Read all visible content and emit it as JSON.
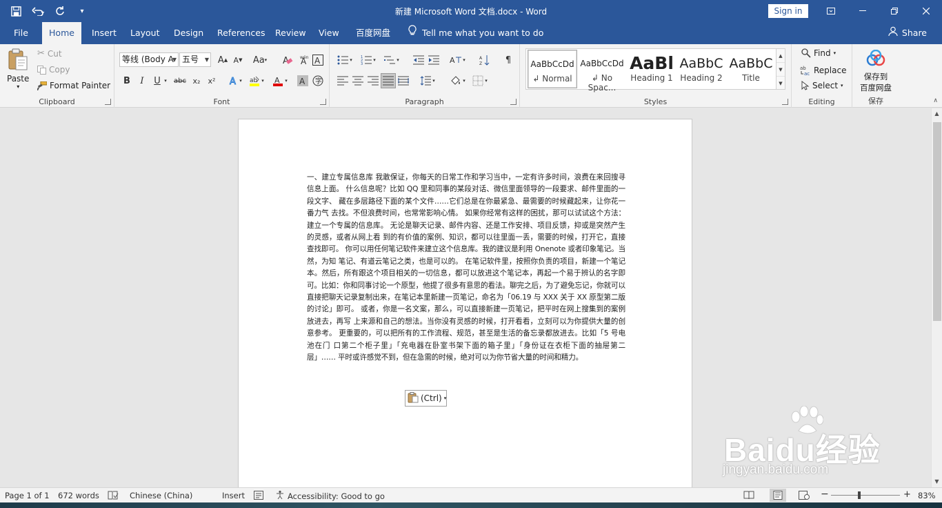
{
  "titlebar": {
    "title": "新建 Microsoft Word 文档.docx  -  Word",
    "sign_in": "Sign in"
  },
  "tabs": {
    "items": [
      "File",
      "Home",
      "Insert",
      "Layout",
      "Design",
      "References",
      "Review",
      "View",
      "百度网盘"
    ],
    "active": "Home",
    "tell_me": "Tell me what you want to do",
    "share": "Share"
  },
  "ribbon": {
    "clipboard": {
      "label": "Clipboard",
      "paste": "Paste",
      "cut": "Cut",
      "copy": "Copy",
      "format_painter": "Format Painter"
    },
    "font": {
      "label": "Font",
      "font_name": "等线 (Body A",
      "font_size": "五号",
      "bold": "B",
      "italic": "I",
      "underline": "U",
      "strikethrough": "abc",
      "subscript": "x₂",
      "superscript": "x²",
      "change_case": "Aa",
      "highlight_color": "#ffff00",
      "font_color": "#e00000"
    },
    "paragraph": {
      "label": "Paragraph"
    },
    "styles": {
      "label": "Styles",
      "items": [
        {
          "sample": "AaBbCcDd",
          "name": "↲ Normal"
        },
        {
          "sample": "AaBbCcDd",
          "name": "↲ No Spac..."
        },
        {
          "sample": "AaBl",
          "name": "Heading 1"
        },
        {
          "sample": "AaBbC",
          "name": "Heading 2"
        },
        {
          "sample": "AaBbC",
          "name": "Title"
        }
      ]
    },
    "editing": {
      "label": "Editing",
      "find": "Find",
      "replace": "Replace",
      "select": "Select"
    },
    "baidu": {
      "label": "保存",
      "button_line1": "保存到",
      "button_line2": "百度网盘"
    }
  },
  "document": {
    "body": "一、建立专属信息库 我敢保证，你每天的日常工作和学习当中，一定有许多时间，浪费在来回搜寻信息上面。 什么信息呢？比如 QQ 里和同事的某段对话、微信里面领导的一段要求、邮件里面的一段文字、 藏在多层路径下面的某个文件……它们总是在你最紧急、最需要的时候藏起来，让你花一番力气 去找。不但浪费时间，也常常影响心情。 如果你经常有这样的困扰，那可以试试这个方法：建立一个专属的信息库。 无论是聊天记录、邮件内容、还是工作安排、项目反馈，抑或是突然产生的灵感，或者从网上看 到的有价值的案例、知识，都可以往里面一丢，需要的时候，打开它，直接查找即可。 你可以用任何笔记软件来建立这个信息库。我的建议是利用 Onenote 或者印象笔记。当然，为知 笔记、有道云笔记之类，也是可以的。 在笔记软件里，按照你负责的项目，新建一个笔记本。然后，所有跟这个项目相关的一切信息，都可以放进这个笔记本，再起一个易于辨认的名字即可。比如：你和同事讨论一个原型，他提了很多有意思的看法。聊完之后，为了避免忘记，你就可以 直接把聊天记录复制出来，在笔记本里新建一页笔记，命名为「06.19 与 XXX 关于 XX 原型第二版 的讨论」即可。 或者，你是一名文案，那么，可以直接新建一页笔记，把平时在网上搜集到的案例放进去，再写 上来源和自己的想法。当你没有灵感的时候，打开看看，立刻可以为你提供大量的创意参考。 更重要的，可以把所有的工作流程、规范，甚至是生活的备忘录都放进去。比如「5 号电池在门 口第二个柜子里」「充电器在卧室书架下面的箱子里」「身份证在衣柜下面的抽屉第二层」…… 平时或许感觉不到，但在急需的时候，绝对可以为你节省大量的时间和精力。",
    "paste_options": "(Ctrl)"
  },
  "statusbar": {
    "page": "Page 1 of 1",
    "words": "672 words",
    "language": "Chinese (China)",
    "mode": "Insert",
    "accessibility": "Accessibility: Good to go",
    "zoom": "83%"
  },
  "watermark": {
    "brand": "Baidu经验",
    "url": "jingyan.baidu.com"
  }
}
